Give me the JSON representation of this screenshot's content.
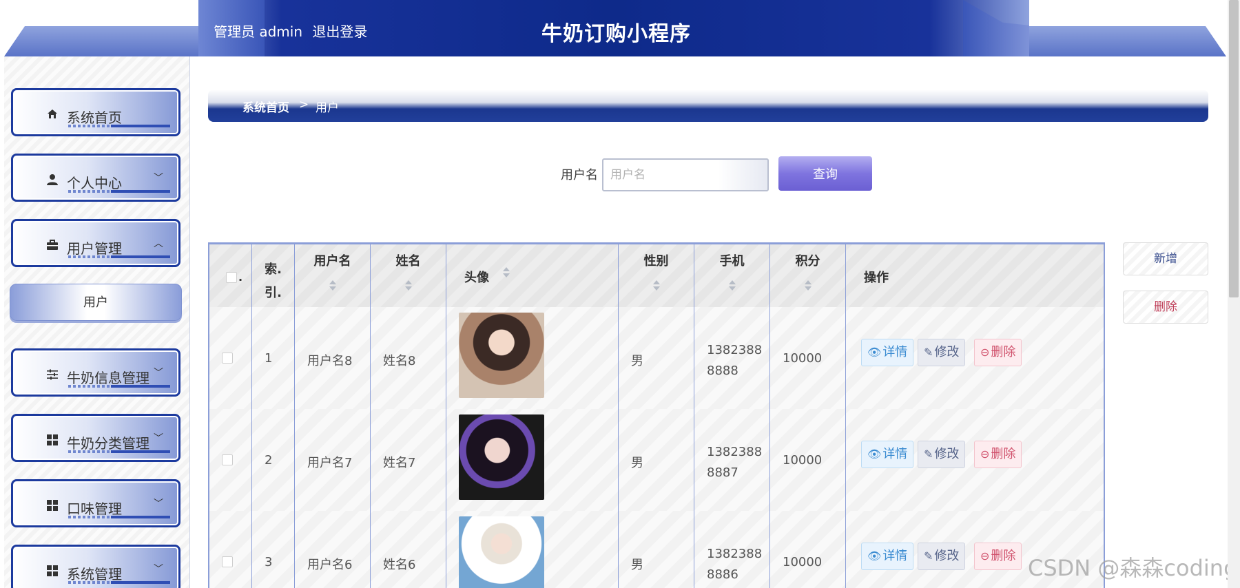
{
  "header": {
    "admin_label": "管理员 admin",
    "logout_label": "退出登录",
    "title": "牛奶订购小程序"
  },
  "sidebar": {
    "items": [
      {
        "label": "系统首页",
        "icon": "home-icon",
        "chevron": ""
      },
      {
        "label": "个人中心",
        "icon": "person-icon",
        "chevron": "﹀"
      },
      {
        "label": "用户管理",
        "icon": "briefcase-icon",
        "chevron": "︿"
      },
      {
        "label": "牛奶信息管理",
        "icon": "sliders-icon",
        "chevron": "﹀"
      },
      {
        "label": "牛奶分类管理",
        "icon": "grid-icon",
        "chevron": "﹀"
      },
      {
        "label": "口味管理",
        "icon": "grid-icon",
        "chevron": "﹀"
      },
      {
        "label": "系统管理",
        "icon": "grid-icon",
        "chevron": "﹀"
      }
    ],
    "submenu": {
      "label": "用户"
    }
  },
  "breadcrumb": {
    "home": "系统首页",
    "separator": ">",
    "current": "用户"
  },
  "search": {
    "label": "用户名",
    "placeholder": "用户名",
    "value": "",
    "button_label": "查询"
  },
  "actions": {
    "add_label": "新增",
    "delete_label": "删除"
  },
  "table": {
    "headers": {
      "index": "索.\n引.",
      "username": "用户名",
      "name": "姓名",
      "avatar": "头像",
      "gender": "性别",
      "phone": "手机",
      "points": "积分",
      "ops": "操作"
    },
    "rows": [
      {
        "index": "1",
        "username": "用户名8",
        "name": "姓名8",
        "gender": "男",
        "phone_line1": "1382388",
        "phone_line2": "8888",
        "points": "10000"
      },
      {
        "index": "2",
        "username": "用户名7",
        "name": "姓名7",
        "gender": "男",
        "phone_line1": "1382388",
        "phone_line2": "8887",
        "points": "10000"
      },
      {
        "index": "3",
        "username": "用户名6",
        "name": "姓名6",
        "gender": "男",
        "phone_line1": "1382388",
        "phone_line2": "8886",
        "points": "10000"
      }
    ],
    "op_labels": {
      "detail": "详情",
      "edit": "修改",
      "delete": "删除"
    }
  },
  "watermark": "CSDN @森森coding",
  "colors": {
    "header_blue": "#0e2a8a",
    "accent_purple": "#7f74df",
    "border_blue": "#8b9ed8",
    "danger": "#d0506b",
    "info": "#3a8bd1"
  }
}
